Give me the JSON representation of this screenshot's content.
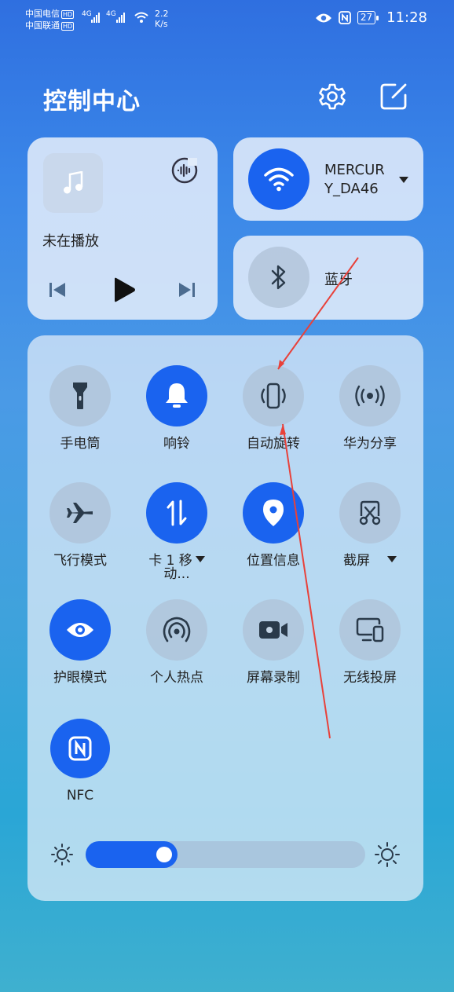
{
  "status_bar": {
    "carrier1": "中国电信",
    "carrier2": "中国联通",
    "hd": "HD",
    "net1": "4G",
    "net2": "4G",
    "speed_value": "2.2",
    "speed_unit": "K/s",
    "battery": "27",
    "time": "11:28"
  },
  "header": {
    "title": "控制中心",
    "settings_icon": "gear-icon",
    "edit_icon": "edit-icon"
  },
  "media": {
    "status": "未在播放",
    "icons": [
      "music-note-icon",
      "audio-output-icon",
      "previous-icon",
      "play-icon",
      "next-icon"
    ]
  },
  "wifi": {
    "network_name_line1": "MERCUR",
    "network_name_line2": "Y_DA46",
    "active": true
  },
  "bluetooth": {
    "label": "蓝牙",
    "active": false
  },
  "toggles": {
    "flashlight": {
      "label": "手电筒",
      "active": false
    },
    "ring": {
      "label": "响铃",
      "active": true
    },
    "auto_rotate": {
      "label": "自动旋转",
      "active": false
    },
    "huawei_share": {
      "label": "华为分享",
      "active": false
    },
    "airplane": {
      "label": "飞行模式",
      "active": false
    },
    "mobile_data_line1": "卡 1 移",
    "mobile_data_line2": "动...",
    "location": {
      "label": "位置信息",
      "active": true
    },
    "screenshot": {
      "label": "截屏",
      "active": false
    },
    "eye_comfort": {
      "label": "护眼模式",
      "active": true
    },
    "hotspot": {
      "label": "个人热点",
      "active": false
    },
    "screen_record": {
      "label": "屏幕录制",
      "active": false
    },
    "wireless_projection": {
      "label": "无线投屏",
      "active": false
    },
    "nfc": {
      "label": "NFC",
      "active": true
    }
  },
  "brightness": {
    "level_fraction": 0.33
  },
  "colors": {
    "accent": "#1a63ef",
    "annotation_arrow": "#e8413a"
  }
}
